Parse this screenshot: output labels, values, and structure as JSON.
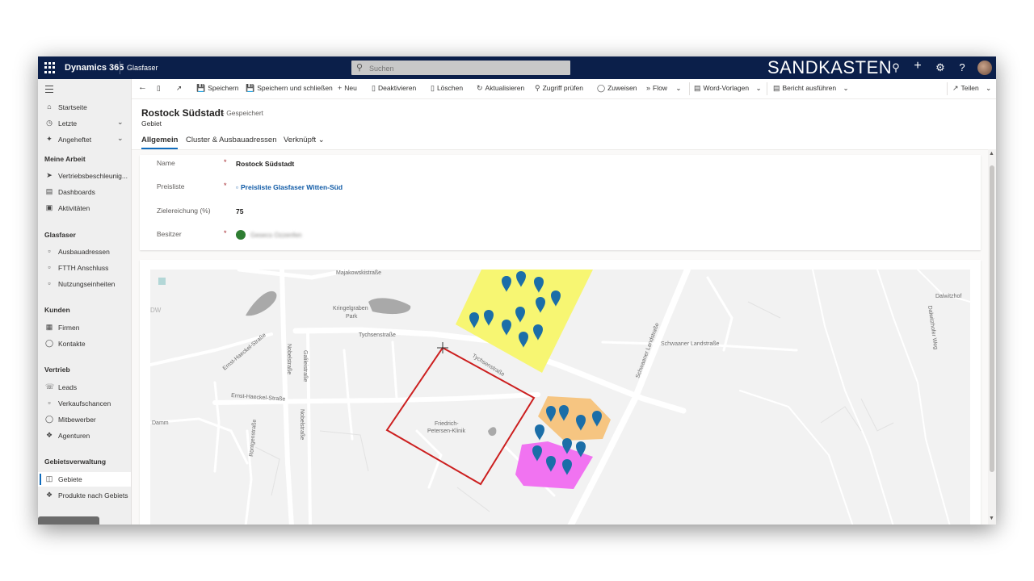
{
  "topbar": {
    "app_name": "Dynamics 365",
    "module": "Glasfaser",
    "search_placeholder": "Suchen",
    "environment": "SANDKASTEN"
  },
  "sidebar": {
    "items_top": [
      {
        "label": "Startseite",
        "icon": "home-icon"
      },
      {
        "label": "Letzte",
        "icon": "clock-icon",
        "chevron": true
      },
      {
        "label": "Angeheftet",
        "icon": "pin-icon",
        "chevron": true
      }
    ],
    "groups": [
      {
        "title": "Meine Arbeit",
        "items": [
          "Vertriebsbeschleunig...",
          "Dashboards",
          "Aktivitäten"
        ]
      },
      {
        "title": "Glasfaser",
        "items": [
          "Ausbauadressen",
          "FTTH Anschluss",
          "Nutzungseinheiten"
        ]
      },
      {
        "title": "Kunden",
        "items": [
          "Firmen",
          "Kontakte"
        ]
      },
      {
        "title": "Vertrieb",
        "items": [
          "Leads",
          "Verkaufschancen",
          "Mitbewerber",
          "Agenturen"
        ]
      },
      {
        "title": "Gebietsverwaltung",
        "items": [
          "Gebiete",
          "Produkte nach Gebiets"
        ]
      }
    ],
    "active_item": "Gebiete"
  },
  "commandbar": {
    "save": "Speichern",
    "save_close": "Speichern und schließen",
    "new": "Neu",
    "deactivate": "Deaktivieren",
    "delete": "Löschen",
    "refresh": "Aktualisieren",
    "check_access": "Zugriff prüfen",
    "assign": "Zuweisen",
    "flow": "Flow",
    "word_templates": "Word-Vorlagen",
    "run_report": "Bericht ausführen",
    "share": "Teilen"
  },
  "record": {
    "title": "Rostock Südstadt",
    "status": "- Gespeichert",
    "entity": "Gebiet"
  },
  "tabs": [
    "Allgemein",
    "Cluster & Ausbauadressen",
    "Verknüpft"
  ],
  "form": {
    "name_label": "Name",
    "name_value": "Rostock Südstadt",
    "pricelist_label": "Preisliste",
    "pricelist_value": "Preisliste Glasfaser Witten-Süd",
    "target_label": "Zielereichung (%)",
    "target_value": "75",
    "owner_label": "Besitzer",
    "owner_value": "Gesecs Ozzenfen",
    "required_mark": "*"
  },
  "map": {
    "streets": {
      "majakowski": "Majakowskistraße",
      "kringelgraben": "Kringelgraben",
      "park": "Park",
      "tychsen1": "Tychsenstraße",
      "tychsen2": "Tychsenstraße",
      "haeckel1": "Ernst-Haeckel-Straße",
      "haeckel2": "Ernst-Haeckel-Straße",
      "nobel1": "Nobelstraße",
      "nobel2": "Nobelstraße",
      "galilei": "Galileistraße",
      "roentgen": "Röntgenstraße",
      "damm": "Damm",
      "schwaaner1": "Schwaaner Landstraße",
      "schwaaner2": "Schwaaner Landstraße",
      "dalwitzhof": "Dalwitzhof",
      "dalwitzhofer": "Dalwitzhofer Weg",
      "klinik1": "Friedrich-",
      "klinik2": "Petersen-Klinik",
      "dow": "DW"
    },
    "cluster_colors": {
      "yellow": "#f7f56a",
      "orange": "#f5c27a",
      "magenta": "#f06cf0"
    },
    "pin_color": "#1b6ea8",
    "territory_color": "#cc1f1f"
  }
}
